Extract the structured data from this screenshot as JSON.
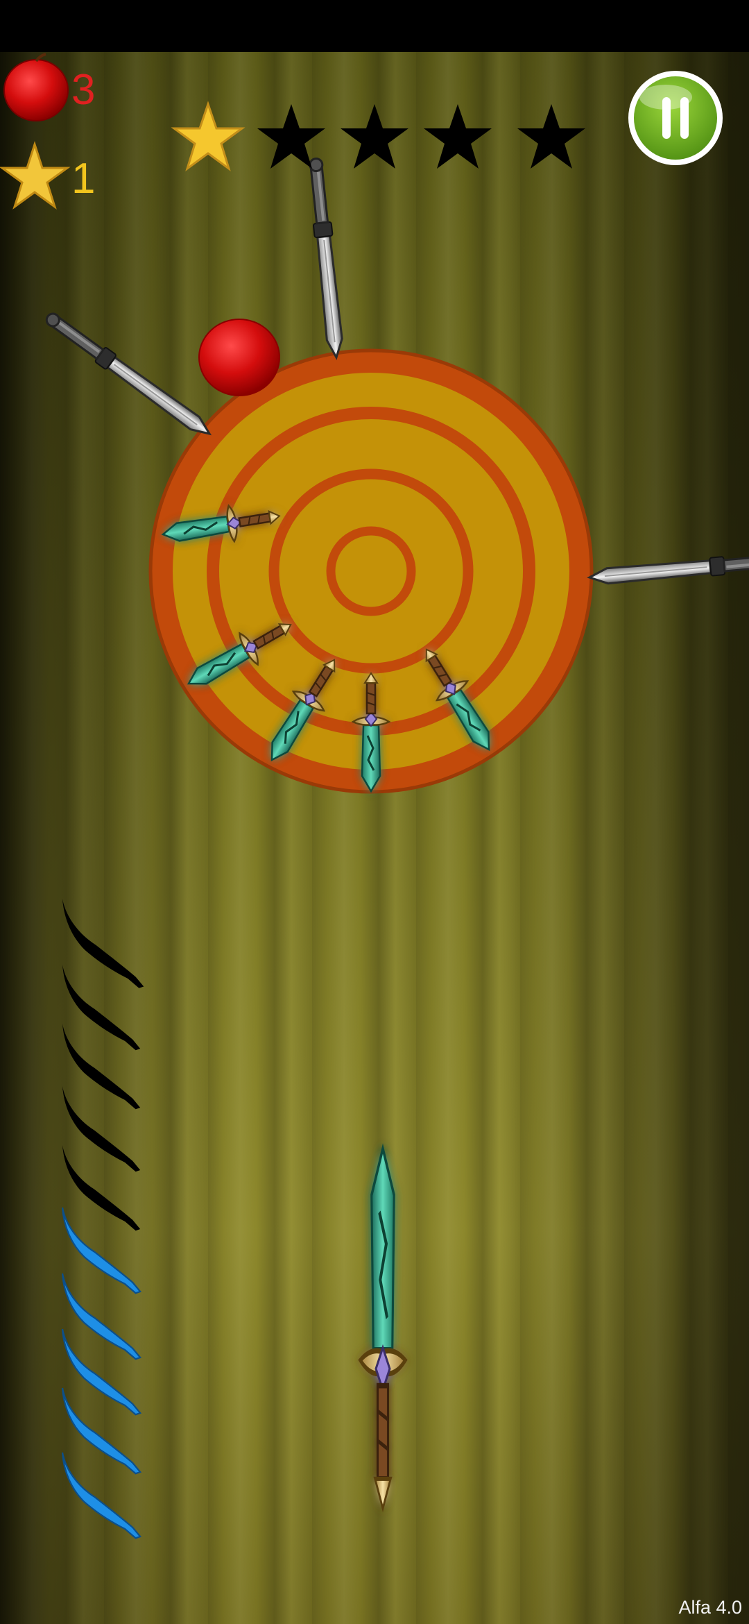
{
  "hud": {
    "apple_icon": "apple-icon",
    "apple_count": "3",
    "apple_count_color": "#e02020",
    "star_icon": "star-icon",
    "star_count": "1",
    "star_count_color": "#f2c51e",
    "pause_icon": "pause-icon"
  },
  "progress": {
    "total_stages": 5,
    "stages_completed": 1,
    "filled_color": "#f5c72e",
    "empty_color": "#000000"
  },
  "knives_remaining": {
    "used_count": 5,
    "available_count": 6,
    "used_color": "#000000",
    "available_color": "#1e8fe6"
  },
  "target": {
    "type": "wood-log-target",
    "ring_color": "#c24a0b",
    "wood_color": "#c49208",
    "apple_on_target": 1
  },
  "stuck_knives": {
    "steel": 3,
    "emerald": 5
  },
  "current_knife": "emerald-sword",
  "version": "Alfa 4.0"
}
